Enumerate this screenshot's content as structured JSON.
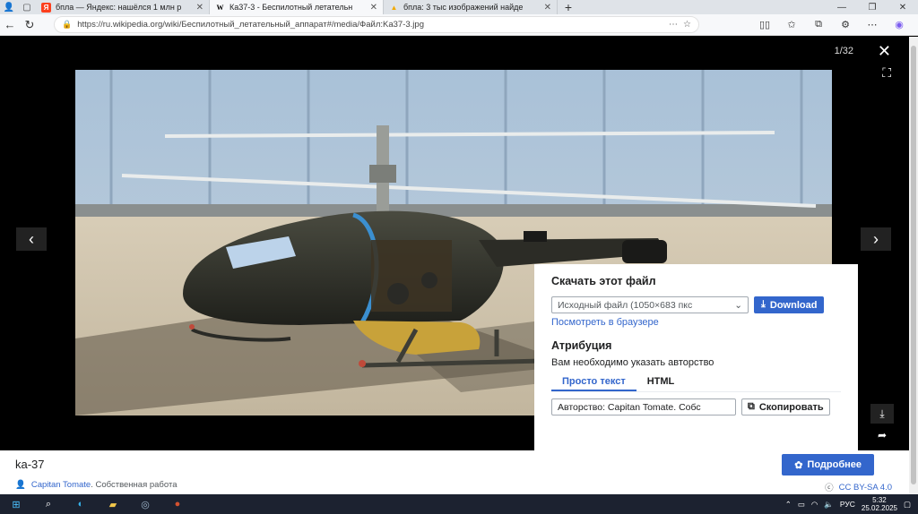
{
  "browser": {
    "tabs": [
      {
        "favicon": "Я",
        "favicon_color": "#fc3f1d",
        "title": "бпла — Яндекс: нашёлся 1 млн р",
        "active": false
      },
      {
        "favicon": "W",
        "favicon_color": "#000000",
        "title": "Ка37-3 - Беспилотный летательн",
        "active": true
      },
      {
        "favicon": "▲",
        "favicon_color": "#f2a900",
        "title": "бпла: 3 тыс изображений найде",
        "active": false
      }
    ],
    "url": "https://ru.wikipedia.org/wiki/Беспилотный_летательный_аппарат#/media/Файл:Ka37-3.jpg"
  },
  "viewer": {
    "counter": "1/32",
    "download_panel": {
      "title": "Скачать этот файл",
      "select_value": "Исходный файл (1050×683 пкс",
      "download_label": "Download",
      "view_in_browser": "Посмотреть в браузере",
      "attribution_title": "Атрибуция",
      "attribution_note": "Вам необходимо указать авторство",
      "tab_plain": "Просто текст",
      "tab_html": "HTML",
      "attribution_value": "Авторство: Capitan Tomate. Собс",
      "copy_label": "Скопировать"
    }
  },
  "footer": {
    "caption": "ka-37",
    "more_label": "Подробнее",
    "author": "Capitan Tomate",
    "source": ". Собственная работа",
    "license": "CC BY-SA 4.0"
  },
  "taskbar": {
    "lang": "РУС",
    "time": "5:32",
    "date": "25.02.2025"
  },
  "colors": {
    "accent": "#3366cc",
    "taskbar": "#1c2230"
  }
}
